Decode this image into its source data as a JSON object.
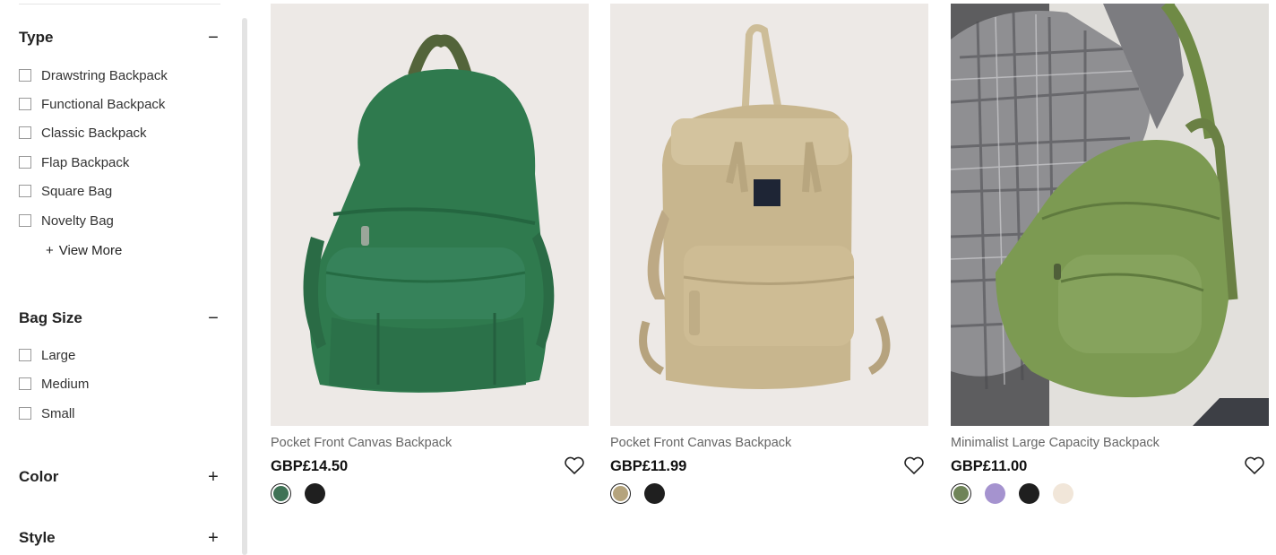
{
  "filters": {
    "type": {
      "title": "Type",
      "toggle": "−",
      "options": [
        "Drawstring Backpack",
        "Functional Backpack",
        "Classic Backpack",
        "Flap Backpack",
        "Square Bag",
        "Novelty Bag"
      ],
      "view_more_icon": "+",
      "view_more": "View More"
    },
    "bag_size": {
      "title": "Bag Size",
      "toggle": "−",
      "options": [
        "Large",
        "Medium",
        "Small"
      ]
    },
    "color": {
      "title": "Color",
      "toggle": "+"
    },
    "style": {
      "title": "Style",
      "toggle": "+"
    }
  },
  "products": [
    {
      "name": "Pocket Front Canvas Backpack",
      "price": "GBP£14.50",
      "swatch_colors": [
        "#3f7255",
        "#1f1f1f"
      ]
    },
    {
      "name": "Pocket Front Canvas Backpack",
      "price": "GBP£11.99",
      "swatch_colors": [
        "#b5a47d",
        "#1f1f1f"
      ]
    },
    {
      "name": "Minimalist Large Capacity Backpack",
      "price": "GBP£11.00",
      "swatch_colors": [
        "#6f8458",
        "#a593cf",
        "#1f1f1f",
        "#f1e6d9"
      ]
    }
  ],
  "icons": {
    "wishlist": "heart-outline-icon",
    "checkbox": "checkbox-empty"
  }
}
